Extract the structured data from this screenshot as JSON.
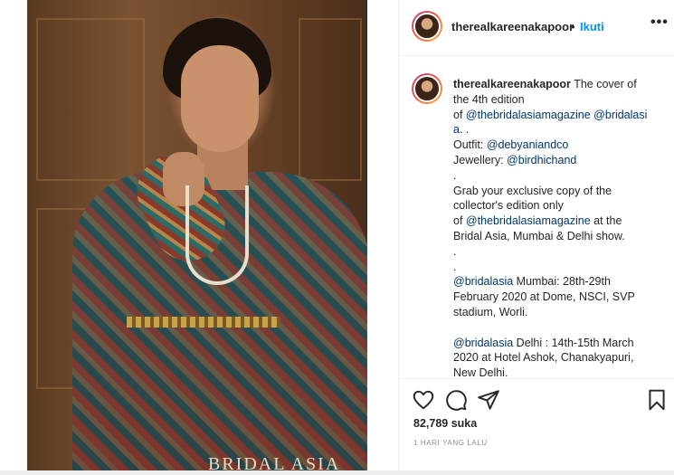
{
  "post": {
    "username": "therealkareenakapoor",
    "dot": "•",
    "follow_label": "Ikuti",
    "more_label": "•••",
    "photo_watermark": "BRIDAL ASIA"
  },
  "caption": {
    "lines": [
      "The cover of",
      "the 4th edition",
      "of @thebridalasiamagazine @bridalasi",
      "a. .",
      "Outfit: @debyaniandco",
      "Jewellery: @birdhichand",
      ".",
      "Grab your exclusive copy of the",
      "collector's edition only",
      "of @thebridalasiamagazine at the",
      "Bridal Asia, Mumbai & Delhi show.",
      ".",
      ".",
      "@bridalasia Mumbai: 28th-29th",
      "February 2020 at Dome, NSCI, SVP",
      "stadium, Worli.",
      "",
      "@bridalasia Delhi : 14th-15th March",
      "2020 at Hotel Ashok, Chanakyapuri,",
      "New Delhi."
    ]
  },
  "actions": {
    "like_icon": "heart-icon",
    "comment_icon": "comment-icon",
    "share_icon": "share-icon",
    "save_icon": "bookmark-icon",
    "likes_text": "82,789 suka",
    "timestamp": "1 HARI YANG LALU"
  },
  "colors": {
    "link": "#00376b",
    "follow": "#0095f6",
    "text": "#262626",
    "muted": "#8e8e8e"
  }
}
